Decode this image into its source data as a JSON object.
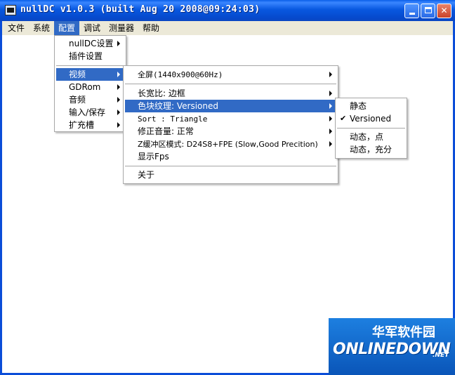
{
  "window": {
    "title": "nullDC v1.0.3 (built Aug 20 2008@09:24:03)"
  },
  "menubar": {
    "items": [
      "文件",
      "系统",
      "配置",
      "调试",
      "测量器",
      "帮助"
    ]
  },
  "config_menu": {
    "items": [
      "nullDC设置",
      "插件设置",
      "视频",
      "GDRom",
      "音频",
      "输入/保存",
      "扩充槽"
    ]
  },
  "video_menu": {
    "items": [
      "全屏(1440x900@60Hz)",
      "长宽比: 边框",
      "色块纹理: Versioned",
      "Sort : Triangle",
      "修正音量: 正常",
      "Z缓冲区模式: D24S8+FPE (Slow,Good Precition)",
      "显示Fps",
      "关于"
    ]
  },
  "texture_menu": {
    "items": [
      "静态",
      "Versioned",
      "动态，点",
      "动态，充分"
    ],
    "checked_index": 1
  },
  "watermark": {
    "cn": "华军软件园",
    "en": "ONLINEDOWN",
    "net": ".NET"
  },
  "colors": {
    "highlight": "#316ac5",
    "titlebar": "#0a5fe8",
    "menubar": "#ece9d8"
  },
  "icons": {
    "app": "app-icon",
    "minimize": "minimize-icon",
    "maximize": "maximize-icon",
    "close": "close-icon",
    "submenu": "chevron-right-icon",
    "check": "check-icon"
  }
}
